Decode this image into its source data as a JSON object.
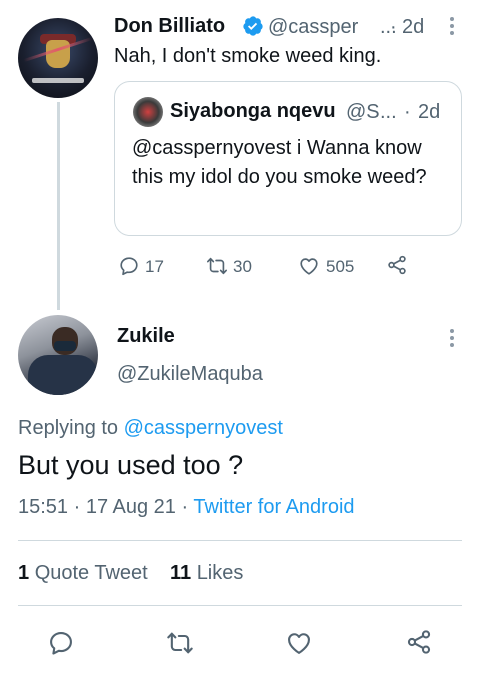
{
  "parent_tweet": {
    "author_name": "Don Billiato",
    "handle": "@cassper",
    "handle_ellipsis": "...",
    "time_sep": "·",
    "time": "2d",
    "text": "Nah, I don't smoke weed king.",
    "verified_icon": "verified-badge-icon",
    "quote": {
      "author_name": "Siyabonga nqevu",
      "handle": "@S",
      "handle_ellipsis": "...",
      "time_sep": "·",
      "time": "2d",
      "text": "@casspernyovest i Wanna know this my idol do you smoke weed?"
    },
    "actions": {
      "reply_count": "17",
      "retweet_count": "30",
      "like_count": "505"
    }
  },
  "main_tweet": {
    "author_name": "Zukile",
    "handle": "@ZukileMaquba",
    "replying_prefix": "Replying to",
    "replying_mention": "@casspernyovest",
    "text": "But you used too ?",
    "timestamp": "15:51 · 17 Aug 21 ·",
    "client": "Twitter for Android",
    "stats": {
      "quote_count": "1",
      "quote_label": "Quote Tweet",
      "like_count": "11",
      "like_label": "Likes"
    }
  },
  "colors": {
    "accent": "#1d9bf0",
    "text_primary": "#0f1419",
    "text_secondary": "#536471",
    "border": "#cfd9de"
  }
}
